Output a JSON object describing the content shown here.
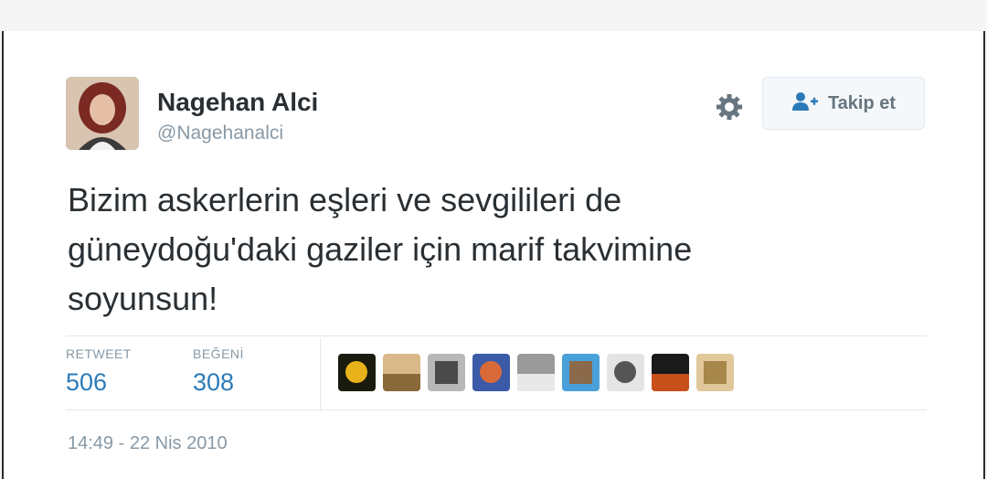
{
  "tweet": {
    "author_name": "Nagehan Alci",
    "author_handle": "@Nagehanalci",
    "text_lines": [
      "Bizim askerlerin eşleri ve sevgilileri de",
      "güneydoğu'daki gaziler için marif takvimine",
      "soyunsun!"
    ],
    "timestamp": "14:49 - 22 Nis 2010"
  },
  "actions": {
    "follow_label": "Takip et",
    "settings_icon": "gear-icon",
    "follow_icon": "add-user-icon"
  },
  "stats": {
    "retweet_label": "RETWEET",
    "retweet_count": "506",
    "like_label": "BEĞENİ",
    "like_count": "308"
  },
  "liker_avatars": [
    {
      "name": "sunflower",
      "colors": [
        "#1a1a0e",
        "#e8b21a"
      ]
    },
    {
      "name": "food-plate",
      "colors": [
        "#d9b98a",
        "#8a6a3a"
      ]
    },
    {
      "name": "striped-road",
      "colors": [
        "#b8b8b8",
        "#4a4a4a"
      ]
    },
    {
      "name": "sunset",
      "colors": [
        "#3b5aa8",
        "#d86a3a"
      ]
    },
    {
      "name": "cat",
      "colors": [
        "#9a9a9a",
        "#e8e8e8"
      ]
    },
    {
      "name": "mountain-sky",
      "colors": [
        "#4aa0d8",
        "#8a6a4a"
      ]
    },
    {
      "name": "gray-abstract",
      "colors": [
        "#e4e4e4",
        "#555555"
      ]
    },
    {
      "name": "dark-orange",
      "colors": [
        "#1a1a1a",
        "#c8501a"
      ]
    },
    {
      "name": "wood-texture",
      "colors": [
        "#e0c89a",
        "#a8884a"
      ]
    }
  ],
  "colors": {
    "name_text": "#292f33",
    "secondary_text": "#8899a6",
    "stat_value": "#2b7bb9",
    "follow_accent": "#2b7bb9"
  }
}
